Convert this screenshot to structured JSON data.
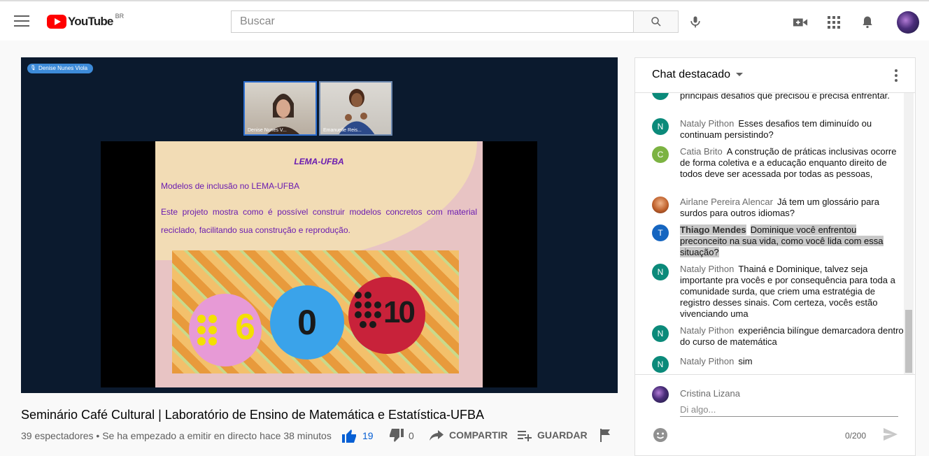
{
  "topbar": {
    "logo_text": "YouTube",
    "logo_country": "BR",
    "search_placeholder": "Buscar"
  },
  "player": {
    "speaker_tag": "Denise Nunes Viola",
    "participants": [
      "Denise Nunes V...",
      "Emanuelle Reis..."
    ],
    "slide": {
      "title": "LEMA-UFBA",
      "heading": "Modelos de inclusão no LEMA-UFBA",
      "text": "Este projeto mostra como é possível construir modelos concretos com material reciclado, facilitando sua construção e reprodução.",
      "numbers": [
        "6",
        "0",
        "10"
      ]
    }
  },
  "video": {
    "title": "Seminário Café Cultural | Laboratório de Ensino de Matemática e Estatística-UFBA",
    "meta": "39 espectadores • Se ha empezado a emitir en directo hace 38 minutos",
    "likes": "19",
    "dislikes": "0",
    "share_label": "COMPARTIR",
    "save_label": "GUARDAR"
  },
  "chat": {
    "header": "Chat destacado",
    "messages": [
      {
        "author": "",
        "text": "principais desafios que precisou e precisa enfrentar.",
        "initial": "",
        "color": "#0f9d58"
      },
      {
        "author": "Nataly Pithon",
        "text": "Esses desafios tem diminuído ou continuam persistindo?",
        "initial": "N",
        "color": "#0b8a7a"
      },
      {
        "author": "Catia Brito",
        "text": "A construção de práticas inclusivas ocorre de forma coletiva e a educação enquanto direito de todos deve ser acessada por todas as pessoas,",
        "initial": "C",
        "color": "#7cb342"
      },
      {
        "author": "Airlane Pereira Alencar",
        "text": "Já tem um glossário para surdos para outros idiomas?",
        "initial": "",
        "color": "#c0622d"
      },
      {
        "author": "Thiago Mendes",
        "text": "Dominique você enfrentou preconceito na sua vida, como você lida com essa situação?",
        "initial": "T",
        "color": "#1565c0"
      },
      {
        "author": "Nataly Pithon",
        "text": "Thainá e Dominique, talvez seja importante pra vocês e por consequência para toda a comunidade surda, que criem uma estratégia de registro desses sinais. Com certeza, vocês estão vivenciando uma",
        "initial": "N",
        "color": "#0b8a7a"
      },
      {
        "author": "Nataly Pithon",
        "text": "experiência bilíngue demarcadora dentro do curso de matemática",
        "initial": "N",
        "color": "#0b8a7a"
      },
      {
        "author": "Nataly Pithon",
        "text": "sim",
        "initial": "N",
        "color": "#0b8a7a"
      }
    ],
    "compose": {
      "user": "Cristina Lizana",
      "placeholder": "Di algo...",
      "counter": "0/200"
    }
  },
  "colors": {
    "youtube_red": "#ff0000",
    "like_blue": "#065fd4",
    "slide_purple": "#6a1bb0"
  }
}
